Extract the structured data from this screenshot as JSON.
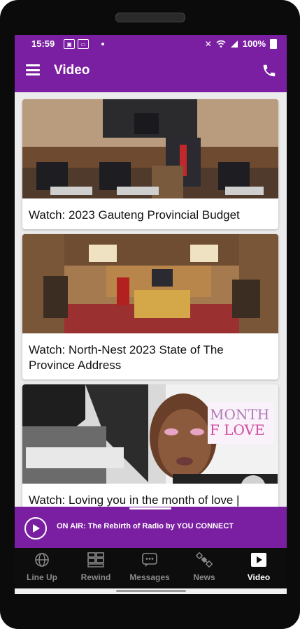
{
  "status": {
    "time": "15:59",
    "battery": "100%"
  },
  "appbar": {
    "title": "Video",
    "menu_icon": "hamburger-icon",
    "call_icon": "phone-icon"
  },
  "videos": [
    {
      "title": "Watch: 2023 Gauteng Provincial Budget"
    },
    {
      "title": "Watch: North-Nest 2023 State of The Province Address"
    },
    {
      "title": "Watch: Loving you in the month of love |"
    }
  ],
  "onair": {
    "text": "ON AIR: The Rebirth of Radio by YOU CONNECT"
  },
  "nav": [
    {
      "label": "Line Up",
      "icon": "globe-icon"
    },
    {
      "label": "Rewind",
      "icon": "grid-icon"
    },
    {
      "label": "Messages",
      "icon": "chat-icon"
    },
    {
      "label": "News",
      "icon": "satellite-icon"
    },
    {
      "label": "Video",
      "icon": "play-icon"
    }
  ],
  "colors": {
    "brand": "#7b1fa2",
    "nav_bg": "#0d0d0d"
  }
}
